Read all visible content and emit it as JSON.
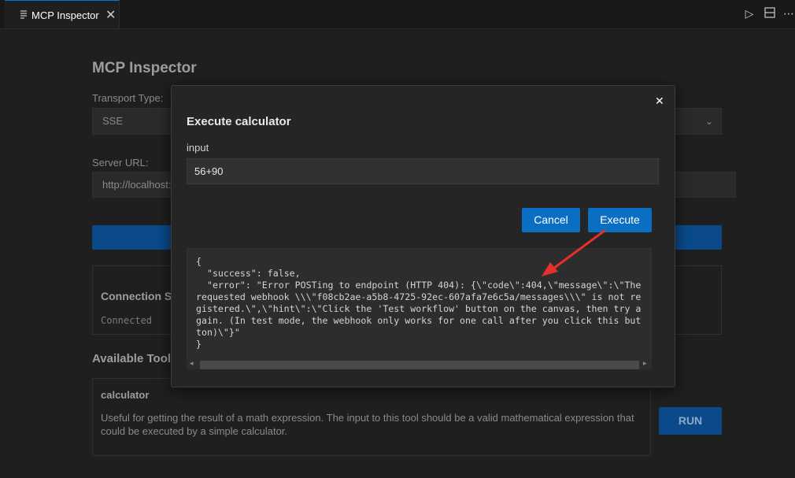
{
  "tab": {
    "title": "MCP Inspector",
    "icon": "document-icon",
    "close": "✕"
  },
  "toolbar": {
    "run_icon": "▷",
    "split_icon": "▥",
    "more_icon": "⋯"
  },
  "page": {
    "title": "MCP Inspector",
    "transport_label": "Transport Type:",
    "transport_value": "SSE",
    "server_url_label": "Server URL:",
    "server_url_value": "http://localhost:",
    "connection_title": "Connection S",
    "connection_status": "Connected",
    "available_tools_title": "Available Tool",
    "tool": {
      "name": "calculator",
      "description": "Useful for getting the result of a math expression. The input to this tool should be a valid mathematical expression that could be executed by a simple calculator.",
      "run_label": "RUN"
    }
  },
  "modal": {
    "close": "✕",
    "title": "Execute calculator",
    "input_label": "input",
    "input_value": "56+90",
    "cancel_label": "Cancel",
    "execute_label": "Execute",
    "result_text": "{\n  \"success\": false,\n  \"error\": \"Error POSTing to endpoint (HTTP 404): {\\\"code\\\":404,\\\"message\\\":\\\"The requested webhook \\\\\\\"f08cb2ae-a5b8-4725-92ec-607afa7e6c5a/messages\\\\\\\" is not registered.\\\",\\\"hint\\\":\\\"Click the 'Test workflow' button on the canvas, then try again. (In test mode, the webhook only works for one call after you click this button)\\\"}\"\n}"
  },
  "colors": {
    "accent": "#0a6fc2",
    "arrow": "#e8302a"
  }
}
